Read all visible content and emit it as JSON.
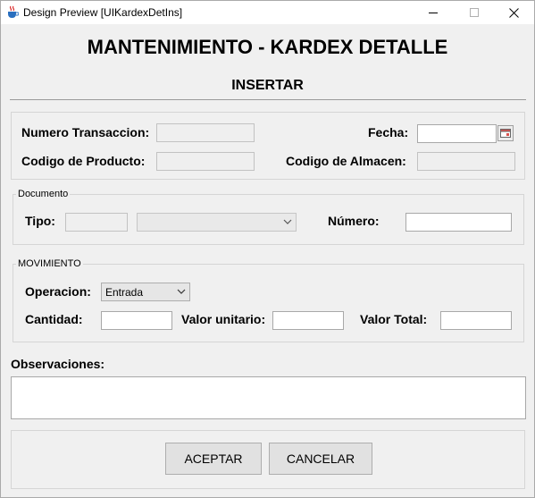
{
  "window": {
    "title": "Design Preview [UIKardexDetIns]",
    "controls": [
      "minimize",
      "maximize",
      "close"
    ]
  },
  "header": {
    "title": "MANTENIMIENTO - KARDEX DETALLE",
    "subtitle": "INSERTAR"
  },
  "general": {
    "numero_transaccion_label": "Numero Transaccion:",
    "numero_transaccion_value": "",
    "fecha_label": "Fecha:",
    "fecha_value": "",
    "codigo_producto_label": "Codigo de Producto:",
    "codigo_producto_value": "",
    "codigo_almacen_label": "Codigo de Almacen:",
    "codigo_almacen_value": ""
  },
  "documento": {
    "legend": "Documento",
    "tipo_label": "Tipo:",
    "tipo_value": "",
    "tipo_combo_value": "",
    "numero_label": "Número:",
    "numero_value": ""
  },
  "movimiento": {
    "legend": "MOVIMIENTO",
    "operacion_label": "Operacion:",
    "operacion_selected": "Entrada",
    "cantidad_label": "Cantidad:",
    "cantidad_value": "",
    "valor_unitario_label": "Valor unitario:",
    "valor_unitario_value": "",
    "valor_total_label": "Valor Total:",
    "valor_total_value": ""
  },
  "observaciones": {
    "label": "Observaciones:",
    "value": ""
  },
  "actions": {
    "accept_label": "ACEPTAR",
    "cancel_label": "CANCELAR"
  },
  "icons": {
    "app": "java-cup-icon",
    "date_picker": "calendar-icon",
    "dropdown": "chevron-down-icon"
  }
}
